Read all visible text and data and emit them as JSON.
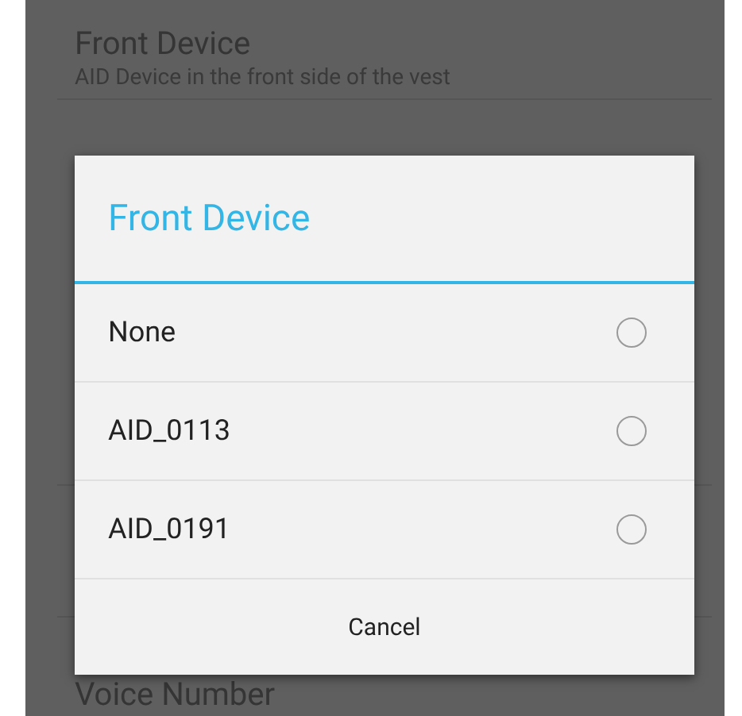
{
  "background_settings": [
    {
      "title": "Front Device",
      "summary": "AID Device in the front side of the vest"
    },
    {
      "title": "Voice Number"
    }
  ],
  "dialog": {
    "title": "Front Device",
    "options": [
      {
        "label": "None",
        "selected": false
      },
      {
        "label": "AID_0113",
        "selected": false
      },
      {
        "label": "AID_0191",
        "selected": false
      }
    ],
    "buttons": [
      "Cancel"
    ]
  }
}
